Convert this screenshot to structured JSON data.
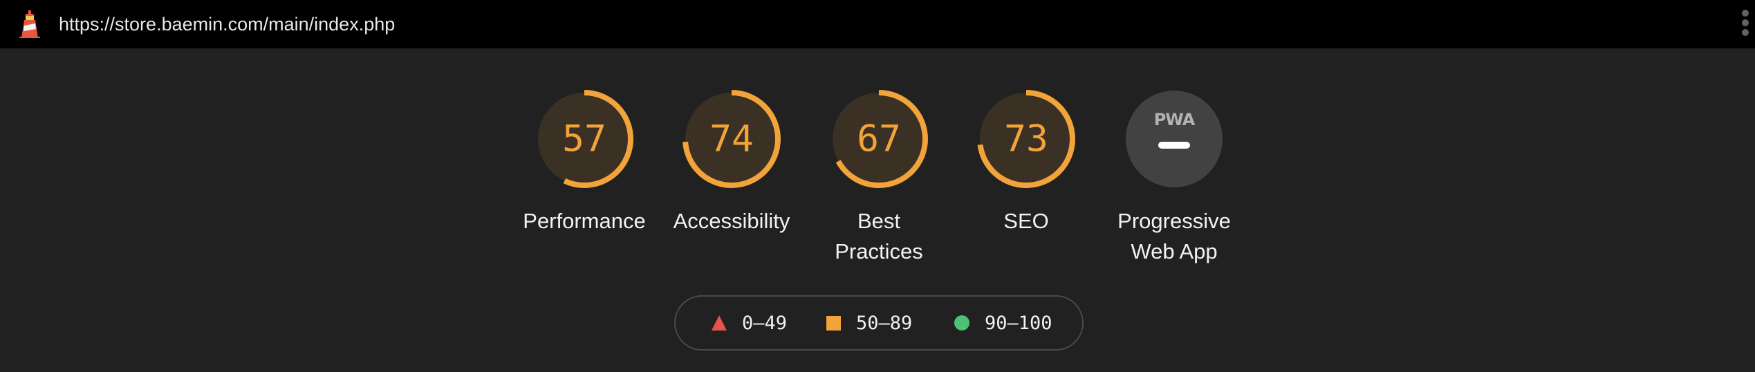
{
  "url": "https://store.baemin.com/main/index.php",
  "colors": {
    "average": "#f2a33a",
    "fail": "#e5534b",
    "pass": "#4cc275",
    "background": "#212121",
    "topbar": "#000000"
  },
  "icons": [
    "lighthouse-icon",
    "more-vert-icon",
    "pwa-badge-icon"
  ],
  "gauges": [
    {
      "score": 57,
      "label": "Performance"
    },
    {
      "score": 74,
      "label": "Accessibility"
    },
    {
      "label_line1": "Best",
      "label_line2": "Practices",
      "score": 67
    },
    {
      "score": 73,
      "label": "SEO"
    },
    {
      "badge": "PWA",
      "label_line1": "Progressive",
      "label_line2": "Web App"
    }
  ],
  "legend": {
    "fail": "0–49",
    "average": "50–89",
    "pass": "90–100"
  }
}
